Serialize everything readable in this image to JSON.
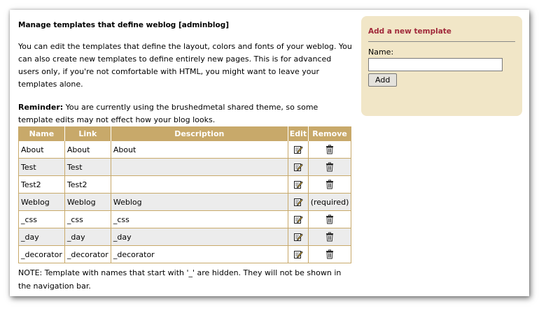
{
  "page": {
    "heading": "Manage templates that define weblog [adminblog]",
    "intro": "You can edit the templates that define the layout, colors and fonts of your weblog. You can also create new templates to define entirely new pages. This is for advanced users only, if you're not comfortable with HTML, you might want to leave your templates alone.",
    "reminder_label": "Reminder:",
    "reminder_text": " You are currently using the brushedmetal shared theme, so some template edits may not effect how your blog looks.",
    "note": "NOTE: Template with names that start with '_' are hidden. They will not be shown in the navigation bar."
  },
  "table": {
    "headers": [
      "Name",
      "Link",
      "Description",
      "Edit",
      "Remove"
    ],
    "rows": [
      {
        "name": "About",
        "link": "About",
        "description": "About",
        "remove": ""
      },
      {
        "name": "Test",
        "link": "Test",
        "description": "",
        "remove": ""
      },
      {
        "name": "Test2",
        "link": "Test2",
        "description": "",
        "remove": ""
      },
      {
        "name": "Weblog",
        "link": "Weblog",
        "description": "Weblog",
        "remove": "(required)"
      },
      {
        "name": "_css",
        "link": "_css",
        "description": "_css",
        "remove": ""
      },
      {
        "name": "_day",
        "link": "_day",
        "description": "_day",
        "remove": ""
      },
      {
        "name": "_decorator",
        "link": "_decorator",
        "description": "_decorator",
        "remove": ""
      }
    ],
    "edit_icon": "edit-icon",
    "remove_icon": "trash-icon"
  },
  "sidebar": {
    "title": "Add a new template",
    "name_label": "Name:",
    "name_value": "",
    "add_button": "Add"
  },
  "colors": {
    "table_header_bg": "#c8a96a",
    "alt_row_bg": "#ececec",
    "panel_bg": "#f1e6c7",
    "panel_title": "#a0293a"
  }
}
